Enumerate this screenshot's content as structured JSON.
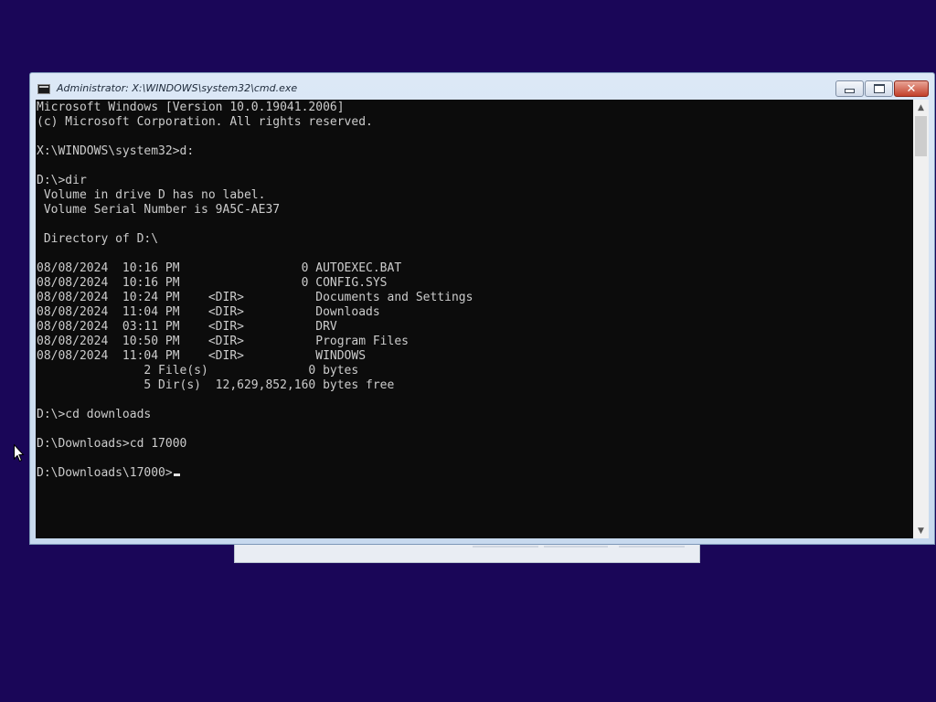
{
  "window": {
    "title": "Administrator: X:\\WINDOWS\\system32\\cmd.exe",
    "icon": "cmd-icon",
    "buttons": {
      "minimize_icon": "minimize-icon",
      "maximize_icon": "maximize-icon",
      "close_icon": "close-icon",
      "close_glyph": "✕"
    }
  },
  "console": {
    "lines": [
      "Microsoft Windows [Version 10.0.19041.2006]",
      "(c) Microsoft Corporation. All rights reserved.",
      "",
      "X:\\WINDOWS\\system32>d:",
      "",
      "D:\\>dir",
      " Volume in drive D has no label.",
      " Volume Serial Number is 9A5C-AE37",
      "",
      " Directory of D:\\",
      "",
      "08/08/2024  10:16 PM                 0 AUTOEXEC.BAT",
      "08/08/2024  10:16 PM                 0 CONFIG.SYS",
      "08/08/2024  10:24 PM    <DIR>          Documents and Settings",
      "08/08/2024  11:04 PM    <DIR>          Downloads",
      "08/08/2024  03:11 PM    <DIR>          DRV",
      "08/08/2024  10:50 PM    <DIR>          Program Files",
      "08/08/2024  11:04 PM    <DIR>          WINDOWS",
      "               2 File(s)              0 bytes",
      "               5 Dir(s)  12,629,852,160 bytes free",
      "",
      "D:\\>cd downloads",
      "",
      "D:\\Downloads>cd 17000",
      ""
    ],
    "prompt": "D:\\Downloads\\17000>"
  },
  "scrollbar": {
    "up_arrow": "▲",
    "down_arrow": "▼"
  },
  "colors": {
    "desktop_background": "#1a0658",
    "console_background": "#0c0c0c",
    "console_text": "#cccccc",
    "close_button": "#c2402a"
  }
}
